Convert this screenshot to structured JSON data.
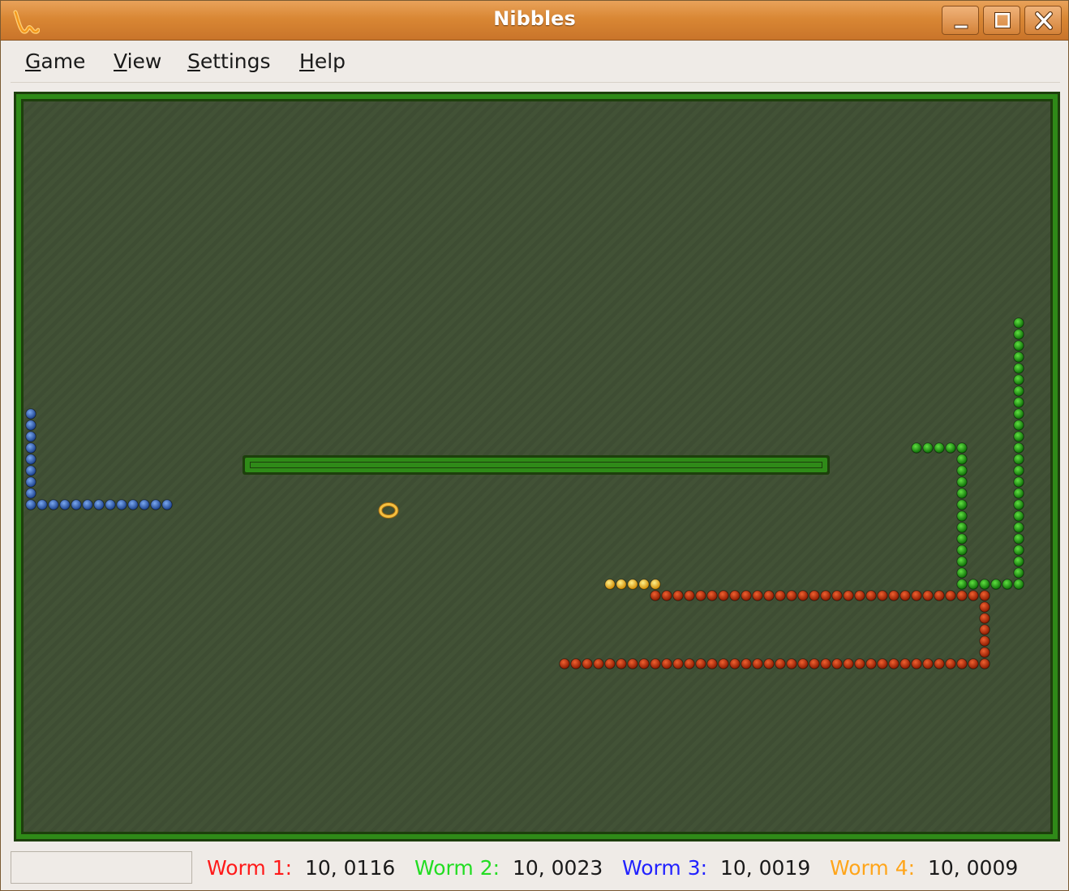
{
  "window": {
    "title": "Nibbles",
    "buttons": {
      "minimize": "minimize-icon",
      "maximize": "maximize-icon",
      "close": "close-icon"
    }
  },
  "menu": {
    "items": [
      {
        "mnemonic": "G",
        "rest": "ame"
      },
      {
        "mnemonic": "V",
        "rest": "iew"
      },
      {
        "mnemonic": "S",
        "rest": "ettings"
      },
      {
        "mnemonic": "H",
        "rest": "elp"
      }
    ]
  },
  "status": {
    "message": "",
    "scores": [
      {
        "label": "Worm 1:",
        "value": "10, 0116",
        "color": "#ff1a1a"
      },
      {
        "label": "Worm 2:",
        "value": "10, 0023",
        "color": "#22dd22"
      },
      {
        "label": "Worm 3:",
        "value": "10, 0019",
        "color": "#2222ff"
      },
      {
        "label": "Worm 4:",
        "value": "10, 0009",
        "color": "#ffa51a"
      }
    ]
  },
  "colors": {
    "board_bg": "#3e4d33",
    "wall": "#2f8a18",
    "worm_red": "#b82a08",
    "worm_green": "#1d9a10",
    "worm_blue": "#2e5fb5",
    "worm_yellow": "#f1b40c",
    "bonus": "#f4c040"
  }
}
